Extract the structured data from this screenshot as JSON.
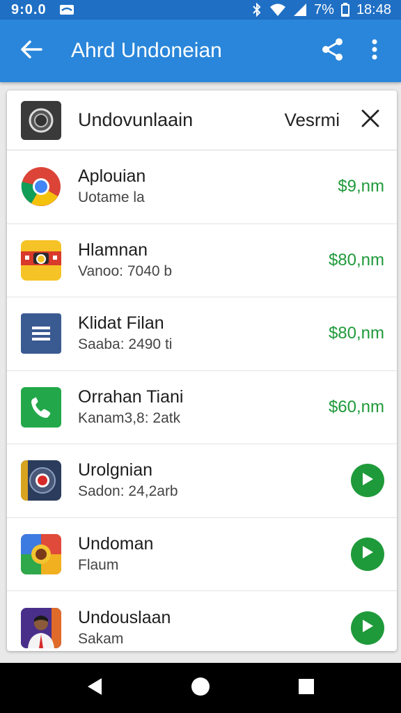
{
  "status_bar": {
    "time_left": "9:0.0",
    "battery": "7%",
    "clock": "18:48"
  },
  "app_bar": {
    "title": "Ahrd Undoneian",
    "back_icon": "arrow-back-icon",
    "share_icon": "share-icon",
    "more_icon": "more-vert-icon"
  },
  "card": {
    "header": {
      "title": "Undovunlaain",
      "version": "Vesrmi",
      "close_icon": "close-icon"
    },
    "items": [
      {
        "name": "Aplouian",
        "sub": "Uotame la",
        "price": "$9,nm",
        "icon": "chrome-icon"
      },
      {
        "name": "Hlamnan",
        "sub": "Vanoo: 7040 b",
        "price": "$80,nm",
        "icon": "camera-app-icon"
      },
      {
        "name": "Klidat Filan",
        "sub": "Saaba: 2490 ti",
        "price": "$80,nm",
        "icon": "notes-app-icon"
      },
      {
        "name": "Orrahan Tiani",
        "sub": "Kanam3,8: 2atk",
        "price": "$60,nm",
        "icon": "phone-app-icon"
      },
      {
        "name": "Urolgnian",
        "sub": "Sadon: 24,2arb",
        "action": "play",
        "icon": "record-app-icon"
      },
      {
        "name": "Undoman",
        "sub": "Flaum",
        "action": "play",
        "icon": "photo-app-icon"
      },
      {
        "name": "Undouslaan",
        "sub": "Sakam",
        "action": "play",
        "icon": "profile-app-icon"
      }
    ]
  },
  "colors": {
    "status_bar": "#1f6fc4",
    "app_bar": "#2a86da",
    "price_green": "#1f9a3a"
  }
}
